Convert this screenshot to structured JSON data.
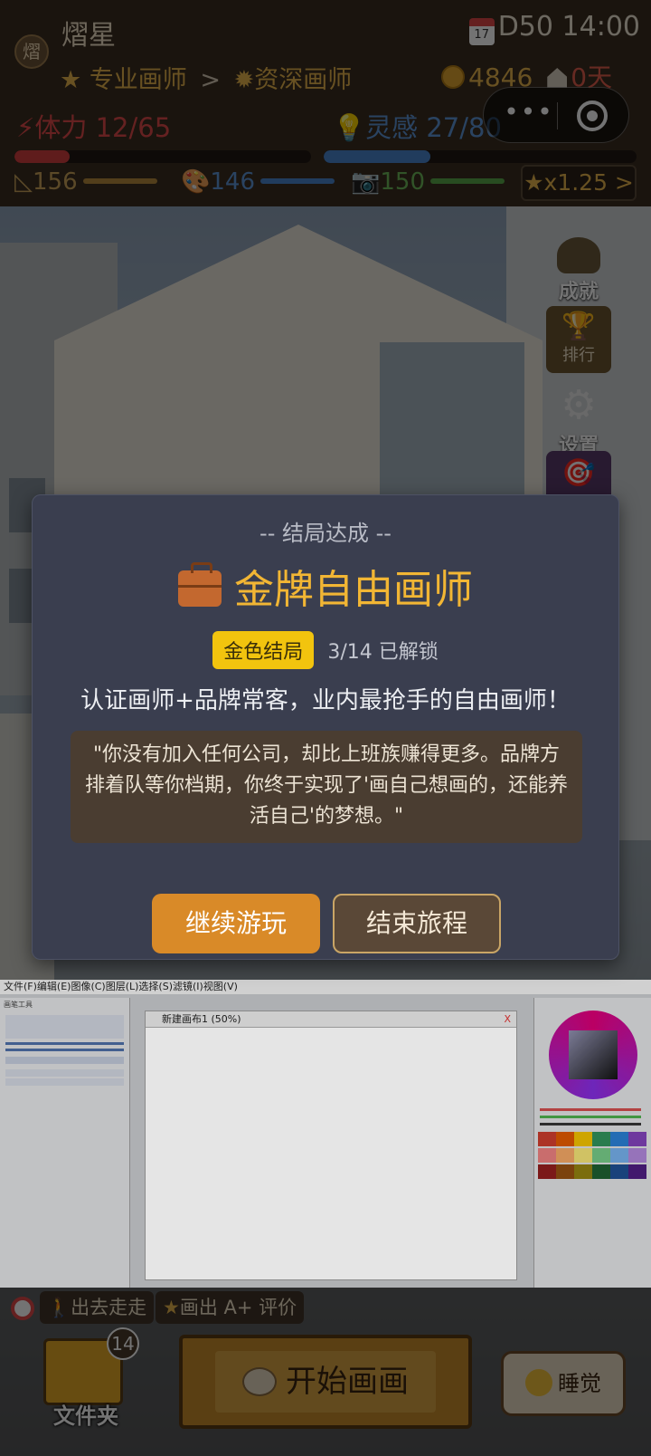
{
  "player": {
    "avatar_char": "熠",
    "name": "熠星",
    "rank_current": "专业画师",
    "rank_arrow": ">",
    "rank_next": "资深画师"
  },
  "status": {
    "calendar_day": "17",
    "day": "D50",
    "time": "14:00",
    "money": "4846",
    "rent_days": "0天"
  },
  "stats": {
    "stamina_label": "体力 12/65",
    "stamina_fraction": 0.185,
    "inspiration_label": "灵感 27/80",
    "inspiration_fraction": 0.34,
    "skill_1": "156",
    "skill_2": "146",
    "skill_3": "150",
    "multiplier": "x1.25 >"
  },
  "colors": {
    "stamina": "#e04b4b",
    "inspiration": "#5d96d8",
    "gold": "#e6b44d",
    "title_gold": "#f2b634",
    "continue_btn": "#d98a28"
  },
  "side_menu": {
    "achievements": "成就",
    "ranking": "排行",
    "settings": "设置"
  },
  "ending_modal": {
    "subtitle": "-- 结局达成 --",
    "title": "金牌自由画师",
    "badge": "金色结局",
    "unlocked": "3/14 已解锁",
    "description": "认证画师+品牌常客，业内最抢手的自由画师！",
    "quote": "\"你没有加入任何公司，却比上班族赚得更多。品牌方排着队等你档期，你终于实现了'画自己想画的，还能养活自己'的梦想。\"",
    "continue_label": "继续游玩",
    "end_label": "结束旅程"
  },
  "drawing_software": {
    "menu": "文件(F)编辑(E)图像(C)图层(L)选择(S)滤镜(I)视图(V)",
    "canvas_title": "新建画布1 (50%)",
    "close": "X",
    "left_panel_title": "画笔工具"
  },
  "bottom": {
    "quest_1": "出去走走",
    "quest_2": "画出 A+ 评价",
    "folder_count": "14",
    "folder_label": "文件夹",
    "start_label": "开始画画",
    "sleep_label": "睡觉"
  }
}
